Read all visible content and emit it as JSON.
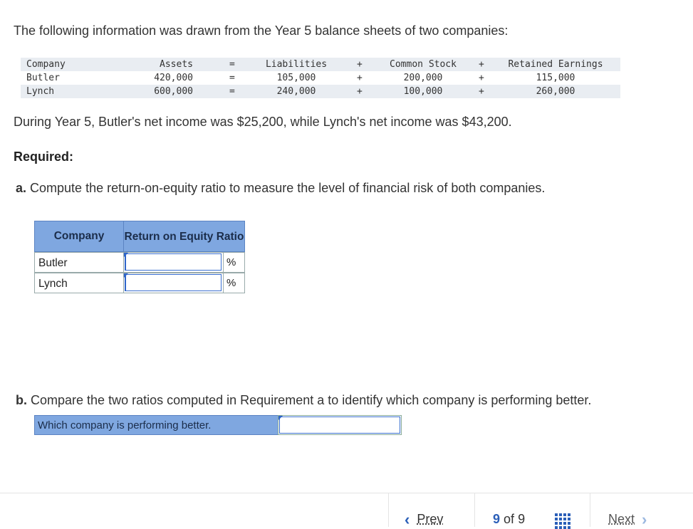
{
  "intro": "The following information was drawn from the Year 5 balance sheets of two companies:",
  "balance_sheet": {
    "headers": [
      "Company",
      "Assets",
      "=",
      "Liabilities",
      "+",
      "Common Stock",
      "+",
      "Retained Earnings"
    ],
    "rows": [
      [
        "Butler",
        "420,000",
        "=",
        "105,000",
        "+",
        "200,000",
        "+",
        "115,000"
      ],
      [
        "Lynch",
        "600,000",
        "=",
        "240,000",
        "+",
        "100,000",
        "+",
        "260,000"
      ]
    ]
  },
  "net_income_text": "During Year 5, Butler's net income was $25,200, while Lynch's net income was $43,200.",
  "required_label": "Required:",
  "part_a": {
    "letter": "a.",
    "text": "Compute the return-on-equity ratio to measure the level of financial risk of both companies."
  },
  "roe_table": {
    "col_company": "Company",
    "col_ratio": "Return on Equity Ratio",
    "rows": [
      {
        "company": "Butler",
        "value": "",
        "unit": "%"
      },
      {
        "company": "Lynch",
        "value": "",
        "unit": "%"
      }
    ]
  },
  "part_b": {
    "letter": "b.",
    "text": "Compare the two ratios computed in Requirement a to identify which company is performing better.",
    "select_label": "Which company is performing better.",
    "select_value": ""
  },
  "nav": {
    "prev_label": "Prev",
    "current_page": "9",
    "of_label": "of",
    "total_pages": "9",
    "next_label": "Next"
  }
}
